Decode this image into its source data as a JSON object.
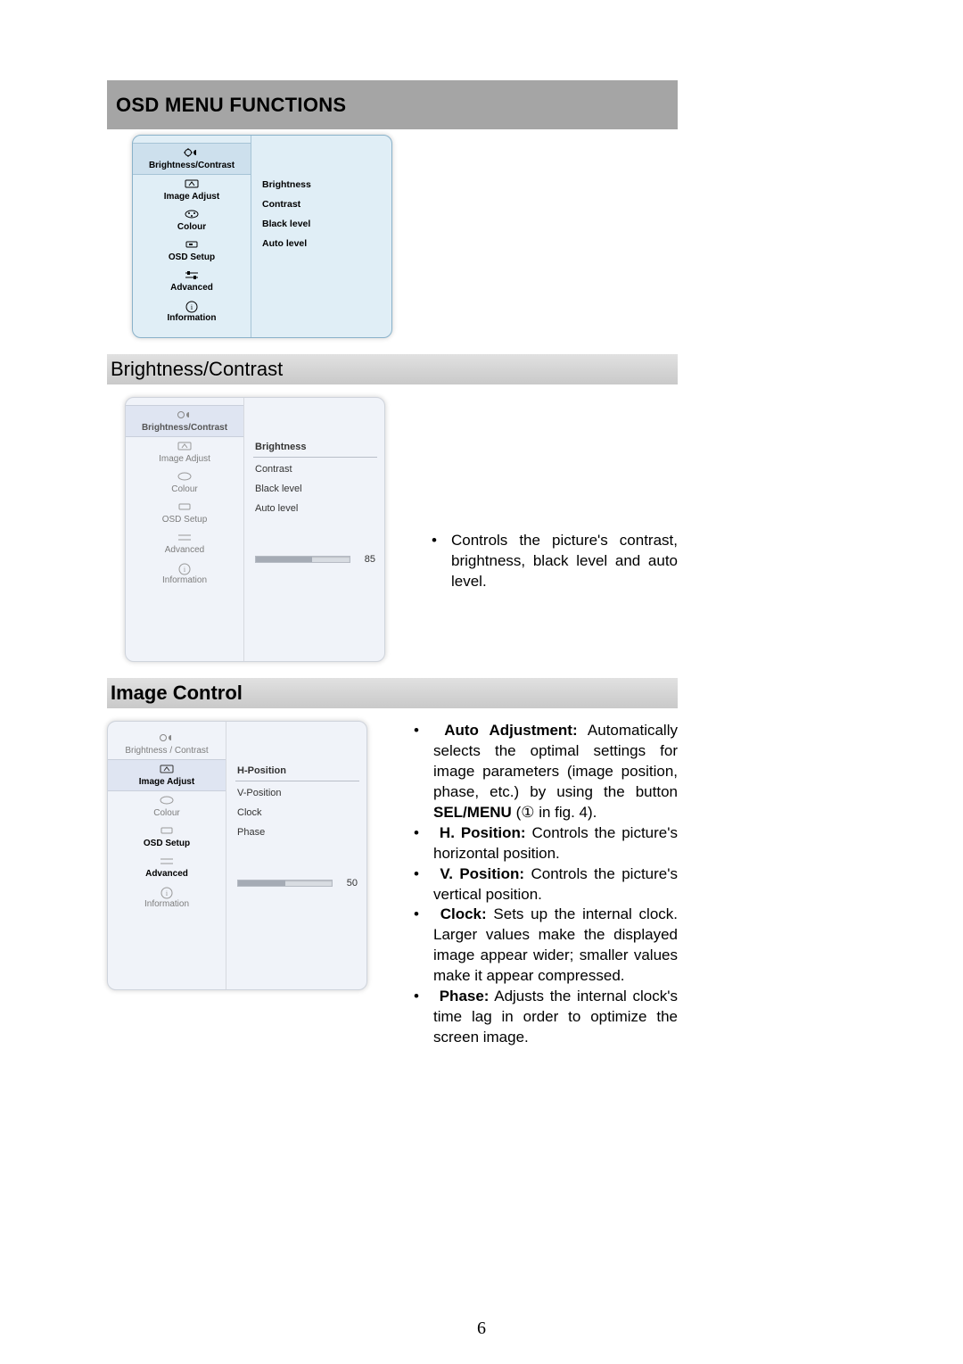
{
  "header": {
    "title": "OSD MENU FUNCTIONS"
  },
  "nav_labels": {
    "brightness_contrast": "Brightness/Contrast",
    "image_adjust": "Image Adjust",
    "colour": "Colour",
    "osd_setup": "OSD Setup",
    "advanced": "Advanced",
    "information": "Information"
  },
  "nav_labels_spaced": {
    "brightness_contrast": "Brightness / Contrast"
  },
  "panel": {
    "brightness_contrast": {
      "options": [
        "Brightness",
        "Contrast",
        "Black level",
        "Auto level"
      ]
    },
    "image_adjust": {
      "options": [
        "H-Position",
        "V-Position",
        "Clock",
        "Phase"
      ]
    }
  },
  "sliders": {
    "brightness": {
      "value": "85",
      "percent": 60
    },
    "hposition": {
      "value": "50",
      "percent": 50
    }
  },
  "sections": {
    "brightness_contrast": {
      "heading": "Brightness/Contrast",
      "text_pre": "Controls the picture's contrast, brightness, black level and auto level."
    },
    "image_control": {
      "heading": "Image Control",
      "bullets": {
        "auto_adj_label": "Auto Adjustment:",
        "auto_adj_text_a": " Automatically selects the optimal settings for image parameters (image position, phase, etc.) by using the button ",
        "sel_menu": "SEL/MENU",
        "auto_adj_text_b": " (① in fig. 4).",
        "h_pos_label": "H. Position:",
        "h_pos_text": " Controls the picture's horizontal position.",
        "v_pos_label": "V. Position:",
        "v_pos_text": " Controls the picture's vertical position.",
        "clock_label": "Clock:",
        "clock_text": " Sets up the internal clock. Larger values make the displayed image appear wider; smaller values make it appear compressed.",
        "phase_label": "Phase:",
        "phase_text": " Adjusts the internal clock's time lag in order to optimize the screen image."
      }
    }
  },
  "page_number": "6"
}
